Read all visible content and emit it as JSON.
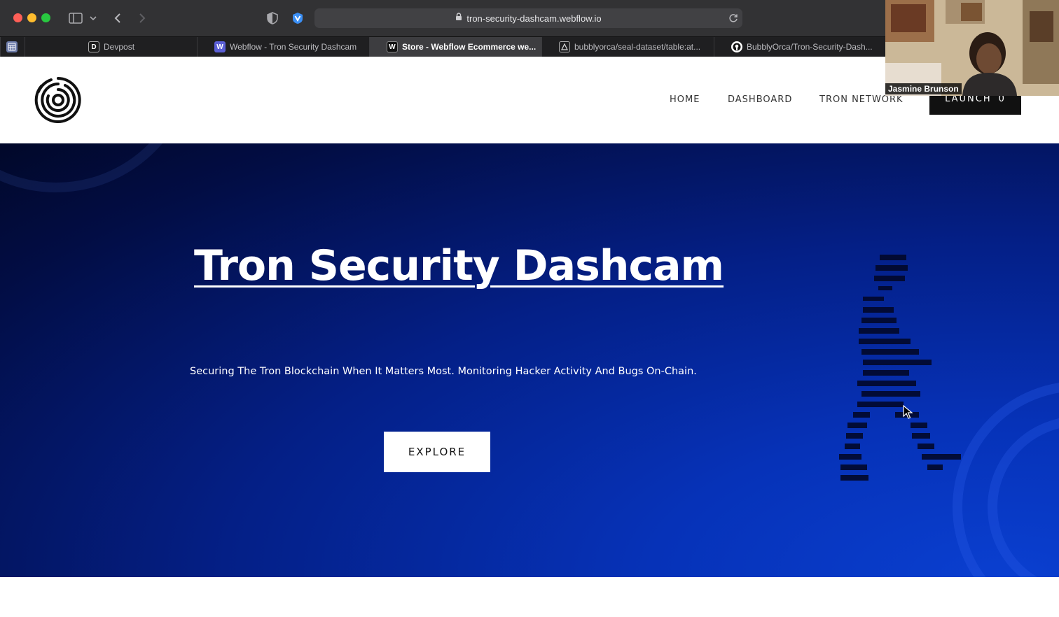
{
  "browser": {
    "url": "tron-security-dashcam.webflow.io",
    "tabs": [
      {
        "label": "Devpost",
        "icon": "devpost-icon",
        "active": false
      },
      {
        "label": "Webflow - Tron Security Dashcam",
        "icon": "webflow-icon",
        "active": false
      },
      {
        "label": "Store - Webflow Ecommerce we...",
        "icon": "webflow-icon",
        "active": true
      },
      {
        "label": "bubblyorca/seal-dataset/table:at...",
        "icon": "hub-icon",
        "active": false
      },
      {
        "label": "BubblyOrca/Tron-Security-Dash...",
        "icon": "github-icon",
        "active": false
      }
    ]
  },
  "webcam": {
    "name": "Jasmine Brunson"
  },
  "site": {
    "nav": {
      "home": "HOME",
      "dashboard": "DASHBOARD",
      "tron_network": "TRON NETWORK",
      "launch": "LAUNCH",
      "launch_count": "0"
    },
    "hero": {
      "title": "Tron Security Dashcam",
      "subtitle": "Securing The Tron Blockchain When It Matters Most. Monitoring Hacker Activity And Bugs On-Chain.",
      "cta": "EXPLORE"
    }
  },
  "colors": {
    "hero_deep": "#010829",
    "hero_bright": "#0a3fd0",
    "nav_text": "#333333",
    "launch_bg": "#111111"
  }
}
